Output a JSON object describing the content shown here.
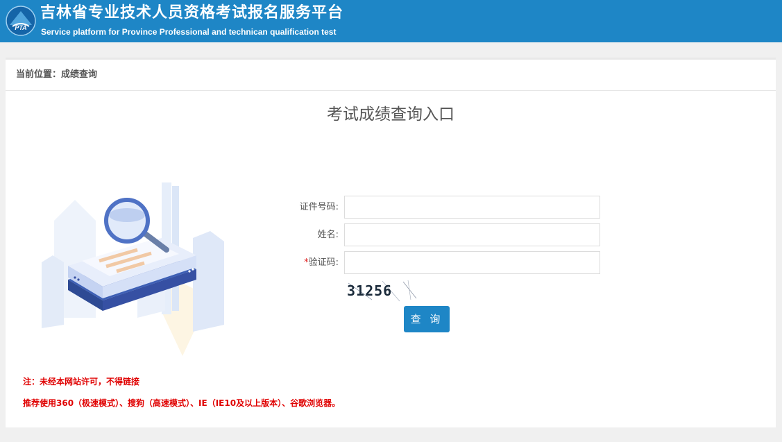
{
  "header": {
    "title": "吉林省专业技术人员资格考试报名服务平台",
    "subtitle": "Service platform for Province Professional and technican qualification test",
    "logo_text": "PTA",
    "bg_color": "#1e86c6"
  },
  "breadcrumb": {
    "text": "当前位置：成绩查询"
  },
  "form": {
    "title": "考试成绩查询入口",
    "id_label": "证件号码:",
    "id_value": "",
    "name_label": "姓名:",
    "name_value": "",
    "captcha_required_mark": "*",
    "captcha_label": "验证码:",
    "captcha_value": "",
    "captcha_image_text": "31256",
    "submit_label": "查 询"
  },
  "notices": {
    "line1": "注：未经本网站许可，不得链接",
    "line2": "推荐使用360（极速模式）、搜狗（高速模式）、IE（IE10及以上版本）、谷歌浏览器。"
  },
  "colors": {
    "accent": "#1e86c6",
    "warning": "#e00000"
  }
}
